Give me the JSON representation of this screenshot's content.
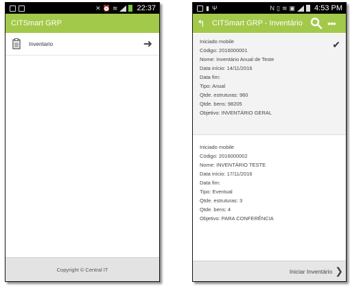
{
  "left_screen": {
    "status_bar": {
      "time": "22:37"
    },
    "app_bar": {
      "title": "CITSmart GRP"
    },
    "menu": [
      {
        "label": "Inventario"
      }
    ],
    "footer": {
      "text": "Copyright © Central IT"
    }
  },
  "right_screen": {
    "status_bar": {
      "time": "4:53 PM"
    },
    "app_bar": {
      "title": "CITSmart GRP - Inventário"
    },
    "cards": [
      {
        "status": "Iniciado mobile",
        "codigo": "Código: 2016000001",
        "nome": "Nome: Inventário Anual de Teste",
        "data_inicio": "Data início: 14/11/2016",
        "data_fim": "Data fim:",
        "tipo": "Tipo: Anual",
        "qtde_estruturas": "Qtde. estruturas: 960",
        "qtde_bens": "Qtde. bens: 98205",
        "objetivo": "Objetivo: INVENTÁRIO GERAL",
        "selected": true
      },
      {
        "status": "Iniciado mobile",
        "codigo": "Código: 2016000002",
        "nome": "Nome: INVENTÁRIO TESTE",
        "data_inicio": "Data início: 17/11/2016",
        "data_fim": "Data fim:",
        "tipo": "Tipo: Eventual",
        "qtde_estruturas": "Qtde. estruturas: 3",
        "qtde_bens": "Qtde. bens: 4",
        "objetivo": "Objetivo: PARA CONFERÊNCIA",
        "selected": false
      }
    ],
    "footer": {
      "action_label": "Iniciar Inventário"
    }
  },
  "colors": {
    "app_bar": "#a3c94a",
    "status_bar": "#000000",
    "footer": "#e6e6e6"
  },
  "icons": {
    "left_menu_item": "clipboard-icon",
    "left_menu_arrow": "arrow-right-icon",
    "back": "back-arrow-icon",
    "search": "search-icon",
    "more": "more-horizontal-icon",
    "selected": "checkmark-icon",
    "footer_action": "chevron-right-icon"
  }
}
